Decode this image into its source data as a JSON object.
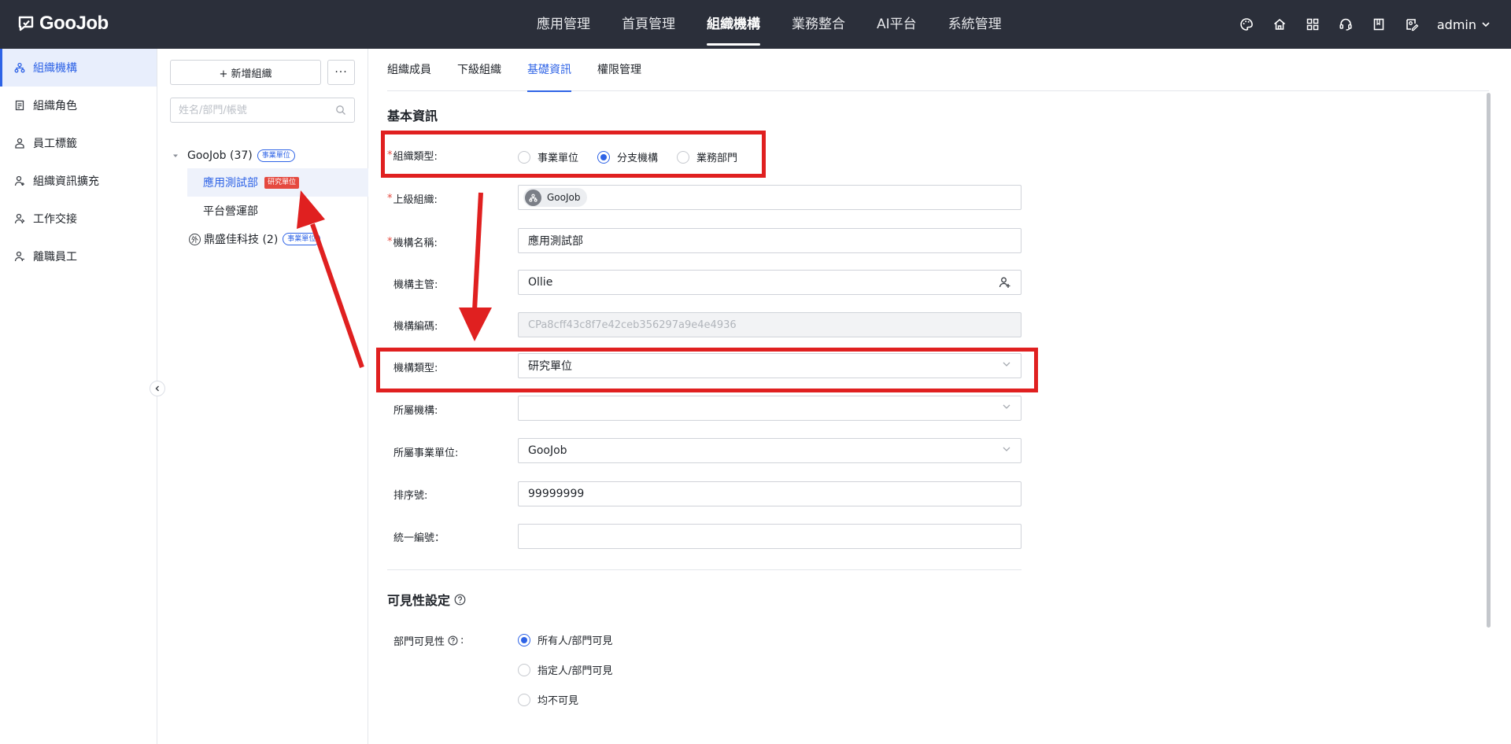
{
  "app": {
    "logo_text": "GooJob"
  },
  "topnav": {
    "items": [
      {
        "label": "應用管理",
        "active": false
      },
      {
        "label": "首頁管理",
        "active": false
      },
      {
        "label": "組織機構",
        "active": true
      },
      {
        "label": "業務整合",
        "active": false
      },
      {
        "label": "AI平台",
        "active": false
      },
      {
        "label": "系統管理",
        "active": false
      }
    ],
    "right_icons": [
      "palette-icon",
      "home-icon",
      "apps-grid-icon",
      "support-headset-icon",
      "book-icon",
      "edit-profile-icon"
    ],
    "user_name": "admin"
  },
  "sidebar": {
    "items": [
      {
        "label": "組織機構",
        "icon": "org-chart-icon",
        "active": true
      },
      {
        "label": "組織角色",
        "icon": "role-document-icon",
        "active": false
      },
      {
        "label": "員工標籤",
        "icon": "employee-tag-icon",
        "active": false
      },
      {
        "label": "組織資訊擴充",
        "icon": "user-extend-icon",
        "active": false
      },
      {
        "label": "工作交接",
        "icon": "handover-user-icon",
        "active": false
      },
      {
        "label": "離職員工",
        "icon": "resigned-user-icon",
        "active": false
      }
    ]
  },
  "tree": {
    "add_button_label": "+ 新增組織",
    "more_button_label": "···",
    "search_placeholder": "姓名/部門/帳號",
    "root": {
      "label": "GooJob (37)",
      "tag": "事業單位"
    },
    "children": [
      {
        "label": "應用測試部",
        "tag": "研究單位",
        "selected": true
      },
      {
        "label": "平台營運部",
        "tag": "",
        "selected": false
      }
    ],
    "external": {
      "label": "鼎盛佳科技 (2)",
      "tag": "事業單位",
      "badge": "外"
    }
  },
  "tabs": [
    {
      "label": "組織成員",
      "active": false
    },
    {
      "label": "下級組織",
      "active": false
    },
    {
      "label": "基礎資訊",
      "active": true
    },
    {
      "label": "權限管理",
      "active": false
    }
  ],
  "form": {
    "section_basic": "基本資訊",
    "org_type": {
      "label": "組織類型:",
      "options": [
        "事業單位",
        "分支機構",
        "業務部門"
      ],
      "selected": "分支機構"
    },
    "parent_org": {
      "label": "上級組織:",
      "value": "GooJob"
    },
    "org_name": {
      "label": "機構名稱:",
      "value": "應用測試部"
    },
    "manager": {
      "label": "機構主管:",
      "value": "Ollie"
    },
    "org_code": {
      "label": "機構編碼:",
      "value": "CPa8cff43c8f7e42ceb356297a9e4e4936"
    },
    "org_category": {
      "label": "機構類型:",
      "value": "研究單位"
    },
    "belong_org": {
      "label": "所屬機構:",
      "value": ""
    },
    "business_unit": {
      "label": "所屬事業單位:",
      "value": "GooJob"
    },
    "sort_no": {
      "label": "排序號:",
      "value": "99999999"
    },
    "unified_no": {
      "label": "統一編號：",
      "value": ""
    },
    "section_visibility": "可見性設定",
    "dept_visibility": {
      "label": "部門可見性",
      "label_suffix": ":",
      "options": [
        "所有人/部門可見",
        "指定人/部門可見",
        "均不可見"
      ],
      "selected": "所有人/部門可見"
    }
  },
  "annotation_color": "#e02020",
  "accent_color": "#2e63e6"
}
